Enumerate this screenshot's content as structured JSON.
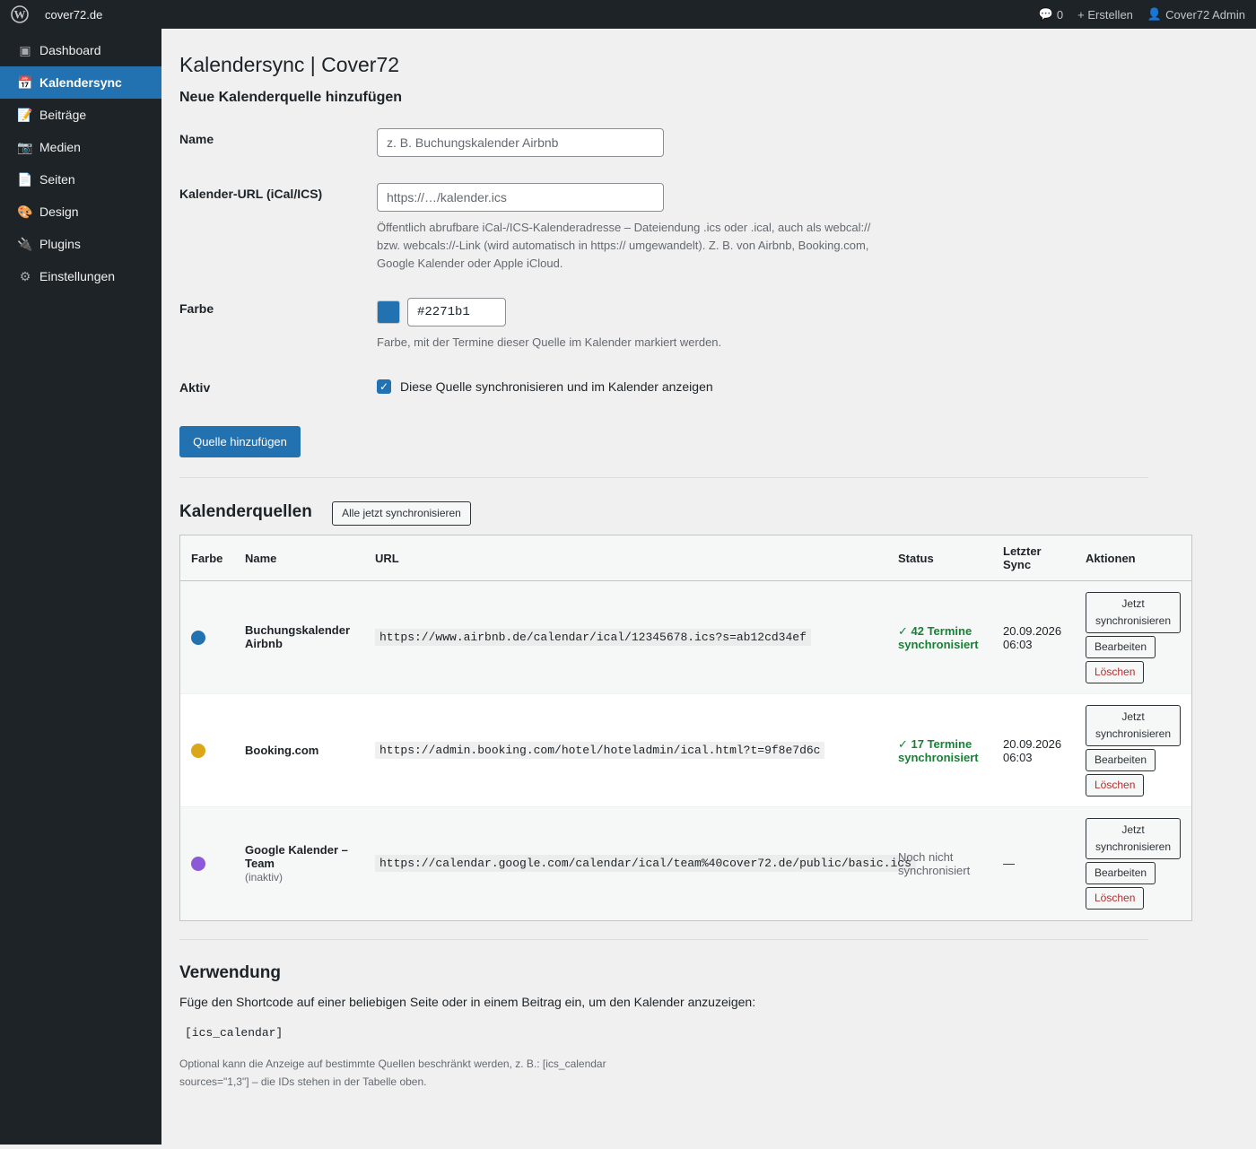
{
  "adminbar": {
    "site_name": "cover72.de",
    "comments_count": "0",
    "create_label": "+ Erstellen",
    "user_label": "Cover72 Admin"
  },
  "sidebar": {
    "items": [
      {
        "label": "Dashboard",
        "icon": "dashboard-icon",
        "glyph": "▣"
      },
      {
        "label": "Kalendersync",
        "icon": "calendar-icon",
        "glyph": "📅"
      },
      {
        "label": "Beiträge",
        "icon": "posts-icon",
        "glyph": "📝"
      },
      {
        "label": "Medien",
        "icon": "media-icon",
        "glyph": "📷"
      },
      {
        "label": "Seiten",
        "icon": "pages-icon",
        "glyph": "📄"
      },
      {
        "label": "Design",
        "icon": "design-icon",
        "glyph": "🎨"
      },
      {
        "label": "Plugins",
        "icon": "plugins-icon",
        "glyph": "🔌"
      },
      {
        "label": "Einstellungen",
        "icon": "settings-icon",
        "glyph": "⚙"
      }
    ],
    "active_index": 1
  },
  "page": {
    "title": "Kalendersync | Cover72",
    "add_section_title": "Neue Kalenderquelle hinzufügen"
  },
  "form": {
    "name_label": "Name",
    "name_placeholder": "z. B. Buchungskalender Airbnb",
    "url_label": "Kalender-URL (iCal/ICS)",
    "url_placeholder": "https://…/kalender.ics",
    "url_description": "Öffentlich abrufbare iCal-/ICS-Kalenderadresse – Dateiendung .ics oder .ical, auch als webcal:// bzw. webcals://-Link (wird automatisch in https:// umgewandelt). Z. B. von Airbnb, Booking.com, Google Kalender oder Apple iCloud.",
    "color_label": "Farbe",
    "color_value": "#2271b1",
    "color_description": "Farbe, mit der Termine dieser Quelle im Kalender markiert werden.",
    "active_label": "Aktiv",
    "active_checked": true,
    "active_checkbox_label": "Diese Quelle synchronisieren und im Kalender anzeigen",
    "submit_label": "Quelle hinzufügen"
  },
  "sources": {
    "title": "Kalenderquellen",
    "sync_all_label": "Alle jetzt synchronisieren",
    "columns": {
      "color": "Farbe",
      "name": "Name",
      "url": "URL",
      "status": "Status",
      "last_sync_1": "Letzter",
      "last_sync_2": "Sync",
      "actions": "Aktionen"
    },
    "rows": [
      {
        "color": "#2271b1",
        "name_1": "Buchungskalender",
        "name_2": "Airbnb",
        "sub": "",
        "url": "https://www.airbnb.de/calendar/ical/12345678.ics?s=ab12cd34ef",
        "status_1": "✓ 42 Termine",
        "status_2": "synchronisiert",
        "status_ok": true,
        "last_sync_1": "20.09.2026",
        "last_sync_2": "06:03"
      },
      {
        "color": "#dba617",
        "name_1": "Booking.com",
        "name_2": "",
        "sub": "",
        "url": "https://admin.booking.com/hotel/hoteladmin/ical.html?t=9f8e7d6c",
        "status_1": "✓ 17 Termine",
        "status_2": "synchronisiert",
        "status_ok": true,
        "last_sync_1": "20.09.2026",
        "last_sync_2": "06:03"
      },
      {
        "color": "#8c5ad8",
        "name_1": "Google Kalender –",
        "name_2": "Team",
        "sub": "(inaktiv)",
        "url": "https://calendar.google.com/calendar/ical/team%40cover72.de/public/basic.ics",
        "status_1": "Noch nicht",
        "status_2": "synchronisiert",
        "status_ok": false,
        "last_sync_1": "—",
        "last_sync_2": ""
      }
    ],
    "action_sync_1": "Jetzt",
    "action_sync_2": "synchronisieren",
    "action_edit": "Bearbeiten",
    "action_delete": "Löschen"
  },
  "usage": {
    "title": "Verwendung",
    "text": "Füge den Shortcode auf einer beliebigen Seite oder in einem Beitrag ein, um den Kalender anzuzeigen:",
    "shortcode": "[ics_calendar]",
    "note": "Optional kann die Anzeige auf bestimmte Quellen beschränkt werden, z. B.: [ics_calendar sources=\"1,3\"] – die IDs stehen in der Tabelle oben."
  }
}
